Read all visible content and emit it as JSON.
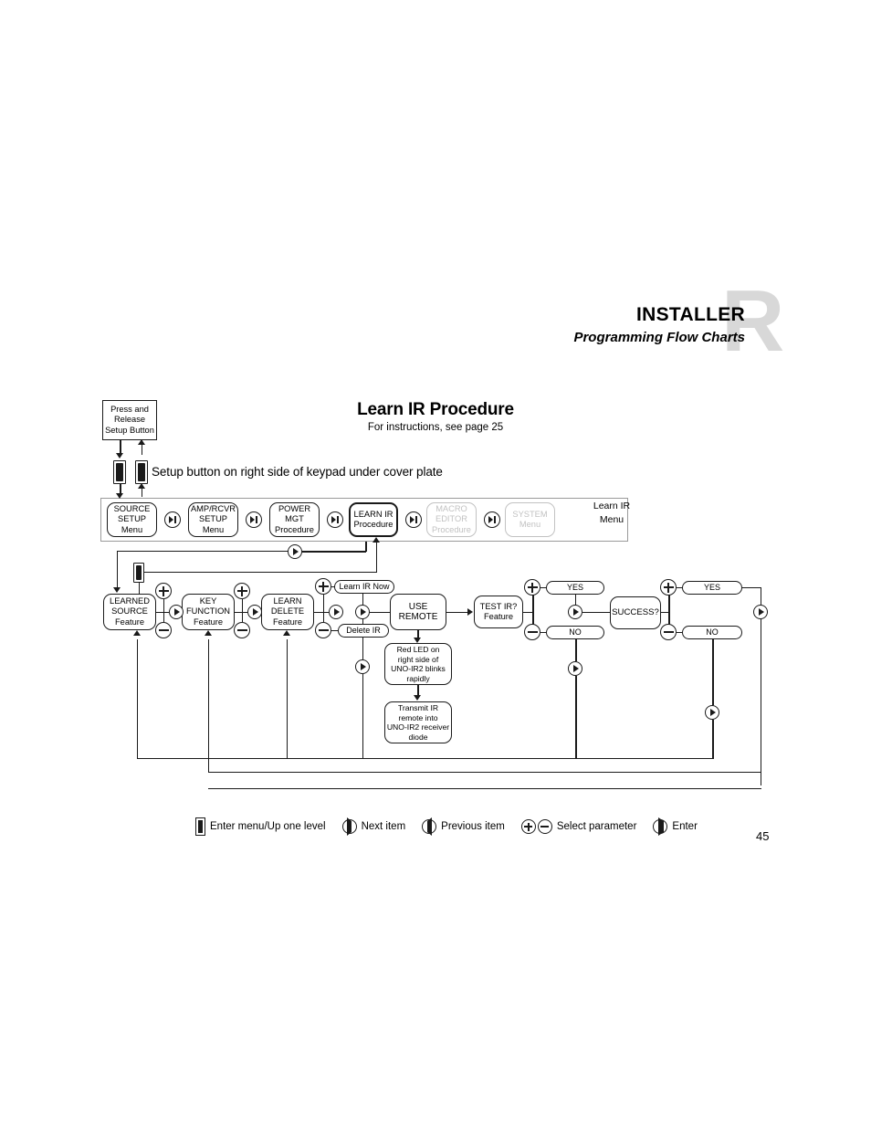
{
  "header": {
    "title": "INSTALLER",
    "subtitle": "Programming Flow Charts",
    "watermark": "R"
  },
  "chart": {
    "title": "Learn IR Procedure",
    "subtitle": "For instructions, see page 25"
  },
  "page_number": "45",
  "setup": {
    "box_line1": "Press and",
    "box_line2": "Release",
    "box_line3": "Setup Button",
    "caption": "Setup button on right side of keypad under cover plate"
  },
  "menu_row": {
    "row_label_line1": "Learn",
    "row_label_line2": "IR",
    "row_label_line3": "Menu",
    "items": [
      {
        "line1": "SOURCE",
        "line2": "SETUP",
        "line3": "Menu",
        "state": "normal"
      },
      {
        "line1": "AMP/RCVR",
        "line2": "SETUP",
        "line3": "Menu",
        "state": "normal"
      },
      {
        "line1": "POWER",
        "line2": "MGT",
        "line3": "Procedure",
        "state": "normal"
      },
      {
        "line1": "LEARN IR",
        "line2": "Procedure",
        "line3": "",
        "state": "selected"
      },
      {
        "line1": "MACRO",
        "line2": "EDITOR",
        "line3": "Procedure",
        "state": "dimmed"
      },
      {
        "line1": "SYSTEM",
        "line2": "Menu",
        "line3": "",
        "state": "dimmed"
      }
    ]
  },
  "features": {
    "learned_source": {
      "line1": "LEARNED",
      "line2": "SOURCE",
      "line3": "Feature"
    },
    "key_function": {
      "line1": "KEY",
      "line2": "FUNCTION",
      "line3": "Feature"
    },
    "learn_delete": {
      "line1": "LEARN",
      "line2": "DELETE",
      "line3": "Feature"
    },
    "learn_ir_now": "Learn IR Now",
    "delete_ir": "Delete IR",
    "use_remote": {
      "line1": "USE",
      "line2": "REMOTE"
    },
    "test_ir": {
      "line1": "TEST IR?",
      "line2": "Feature"
    },
    "success": "SUCCESS?",
    "yes_1": "YES",
    "no_1": "NO",
    "yes_2": "YES",
    "no_2": "NO"
  },
  "instructions": {
    "red_led": {
      "line1": "Red LED on",
      "line2": "right side of",
      "line3": "UNO-IR2 blinks",
      "line4": "rapidly"
    },
    "transmit": {
      "line1": "Transmit IR",
      "line2": "remote into",
      "line3": "UNO-IR2 receiver",
      "line4": "diode"
    }
  },
  "legend": [
    {
      "icon": "setup-button-icon",
      "label": "Enter menu/Up one level"
    },
    {
      "icon": "skip-forward-icon",
      "label": "Next item"
    },
    {
      "icon": "skip-backward-icon",
      "label": "Previous item"
    },
    {
      "icon": "plus-minus-icon",
      "label": "Select parameter"
    },
    {
      "icon": "play-enter-icon",
      "label": "Enter"
    }
  ],
  "colors": {
    "ink": "#1a1a1a",
    "dimmed": "#c2c2c2",
    "frame": "#9a9a9a",
    "watermark": "#d8d8d8"
  }
}
